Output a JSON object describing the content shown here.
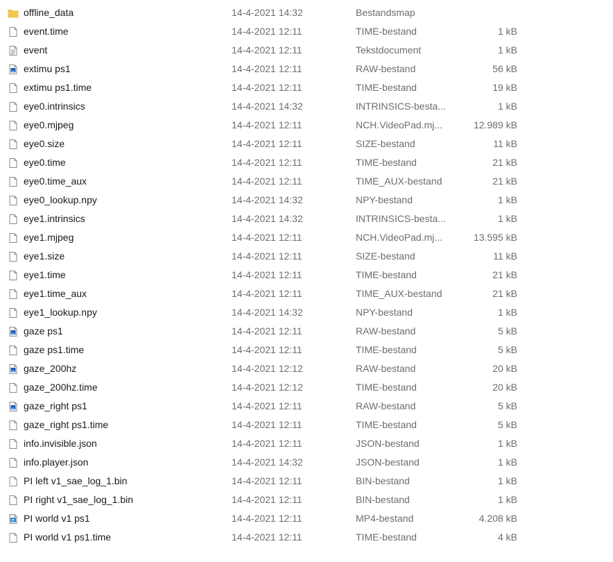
{
  "files": [
    {
      "name": "offline_data",
      "modified": "14-4-2021 14:32",
      "type": "Bestandsmap",
      "size": "",
      "icon": "folder-icon"
    },
    {
      "name": "event.time",
      "modified": "14-4-2021 12:11",
      "type": "TIME-bestand",
      "size": "1 kB",
      "icon": "blank-file-icon"
    },
    {
      "name": "event",
      "modified": "14-4-2021 12:11",
      "type": "Tekstdocument",
      "size": "1 kB",
      "icon": "text-document-icon"
    },
    {
      "name": "extimu ps1",
      "modified": "14-4-2021 12:11",
      "type": "RAW-bestand",
      "size": "56 kB",
      "icon": "image-file-icon"
    },
    {
      "name": "extimu ps1.time",
      "modified": "14-4-2021 12:11",
      "type": "TIME-bestand",
      "size": "19 kB",
      "icon": "blank-file-icon"
    },
    {
      "name": "eye0.intrinsics",
      "modified": "14-4-2021 14:32",
      "type": "INTRINSICS-besta...",
      "size": "1 kB",
      "icon": "blank-file-icon"
    },
    {
      "name": "eye0.mjpeg",
      "modified": "14-4-2021 12:11",
      "type": "NCH.VideoPad.mj...",
      "size": "12.989 kB",
      "icon": "blank-file-icon"
    },
    {
      "name": "eye0.size",
      "modified": "14-4-2021 12:11",
      "type": "SIZE-bestand",
      "size": "11 kB",
      "icon": "blank-file-icon"
    },
    {
      "name": "eye0.time",
      "modified": "14-4-2021 12:11",
      "type": "TIME-bestand",
      "size": "21 kB",
      "icon": "blank-file-icon"
    },
    {
      "name": "eye0.time_aux",
      "modified": "14-4-2021 12:11",
      "type": "TIME_AUX-bestand",
      "size": "21 kB",
      "icon": "blank-file-icon"
    },
    {
      "name": "eye0_lookup.npy",
      "modified": "14-4-2021 14:32",
      "type": "NPY-bestand",
      "size": "1 kB",
      "icon": "blank-file-icon"
    },
    {
      "name": "eye1.intrinsics",
      "modified": "14-4-2021 14:32",
      "type": "INTRINSICS-besta...",
      "size": "1 kB",
      "icon": "blank-file-icon"
    },
    {
      "name": "eye1.mjpeg",
      "modified": "14-4-2021 12:11",
      "type": "NCH.VideoPad.mj...",
      "size": "13.595 kB",
      "icon": "blank-file-icon"
    },
    {
      "name": "eye1.size",
      "modified": "14-4-2021 12:11",
      "type": "SIZE-bestand",
      "size": "11 kB",
      "icon": "blank-file-icon"
    },
    {
      "name": "eye1.time",
      "modified": "14-4-2021 12:11",
      "type": "TIME-bestand",
      "size": "21 kB",
      "icon": "blank-file-icon"
    },
    {
      "name": "eye1.time_aux",
      "modified": "14-4-2021 12:11",
      "type": "TIME_AUX-bestand",
      "size": "21 kB",
      "icon": "blank-file-icon"
    },
    {
      "name": "eye1_lookup.npy",
      "modified": "14-4-2021 14:32",
      "type": "NPY-bestand",
      "size": "1 kB",
      "icon": "blank-file-icon"
    },
    {
      "name": "gaze ps1",
      "modified": "14-4-2021 12:11",
      "type": "RAW-bestand",
      "size": "5 kB",
      "icon": "image-file-icon"
    },
    {
      "name": "gaze ps1.time",
      "modified": "14-4-2021 12:11",
      "type": "TIME-bestand",
      "size": "5 kB",
      "icon": "blank-file-icon"
    },
    {
      "name": "gaze_200hz",
      "modified": "14-4-2021 12:12",
      "type": "RAW-bestand",
      "size": "20 kB",
      "icon": "image-file-icon"
    },
    {
      "name": "gaze_200hz.time",
      "modified": "14-4-2021 12:12",
      "type": "TIME-bestand",
      "size": "20 kB",
      "icon": "blank-file-icon"
    },
    {
      "name": "gaze_right ps1",
      "modified": "14-4-2021 12:11",
      "type": "RAW-bestand",
      "size": "5 kB",
      "icon": "image-file-icon"
    },
    {
      "name": "gaze_right ps1.time",
      "modified": "14-4-2021 12:11",
      "type": "TIME-bestand",
      "size": "5 kB",
      "icon": "blank-file-icon"
    },
    {
      "name": "info.invisible.json",
      "modified": "14-4-2021 12:11",
      "type": "JSON-bestand",
      "size": "1 kB",
      "icon": "blank-file-icon"
    },
    {
      "name": "info.player.json",
      "modified": "14-4-2021 14:32",
      "type": "JSON-bestand",
      "size": "1 kB",
      "icon": "blank-file-icon"
    },
    {
      "name": "PI left v1_sae_log_1.bin",
      "modified": "14-4-2021 12:11",
      "type": "BIN-bestand",
      "size": "1 kB",
      "icon": "blank-file-icon"
    },
    {
      "name": "PI right v1_sae_log_1.bin",
      "modified": "14-4-2021 12:11",
      "type": "BIN-bestand",
      "size": "1 kB",
      "icon": "blank-file-icon"
    },
    {
      "name": "PI world v1 ps1",
      "modified": "14-4-2021 12:11",
      "type": "MP4-bestand",
      "size": "4.208 kB",
      "icon": "video-file-icon"
    },
    {
      "name": "PI world v1 ps1.time",
      "modified": "14-4-2021 12:11",
      "type": "TIME-bestand",
      "size": "4 kB",
      "icon": "blank-file-icon"
    }
  ],
  "colors": {
    "folder": "#f4c74f",
    "folder_dark": "#e6a820",
    "file_border": "#8a8a8a",
    "image_blue": "#1e5fb8",
    "video_blue": "#2a86d9",
    "text_secondary": "#6d6d6d"
  }
}
